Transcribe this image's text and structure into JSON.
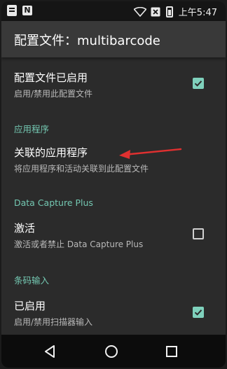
{
  "status_bar": {
    "time": "上午5:47",
    "icons": [
      "notification-app-icon",
      "n-icon",
      "wifi-icon",
      "sim-x-icon",
      "battery-icon"
    ]
  },
  "app_bar": {
    "title": "配置文件：multibarcode"
  },
  "profile_enabled": {
    "title": "配置文件已启用",
    "subtitle": "启用/禁用此配置文件",
    "checked": true
  },
  "section_apps": {
    "header": "应用程序",
    "associated_apps": {
      "title": "关联的应用程序",
      "subtitle": "将应用程序和活动关联到此配置文件"
    }
  },
  "section_dcp": {
    "header": "Data Capture Plus",
    "activate": {
      "title": "激活",
      "subtitle": "激活或者禁止 Data Capture Plus",
      "checked": false
    }
  },
  "section_barcode": {
    "header": "条码输入",
    "enabled": {
      "title": "已启用",
      "subtitle": "启用/禁用扫描器输入",
      "checked": true
    }
  },
  "nav_bar": {
    "buttons": [
      "back-icon",
      "home-icon",
      "recents-icon"
    ]
  },
  "colors": {
    "accent": "#74c8b2",
    "checkbox_checked": "#7fd1bc",
    "annotation_arrow": "#e03030",
    "background": "#2b2b2b",
    "app_bar": "#393939"
  }
}
